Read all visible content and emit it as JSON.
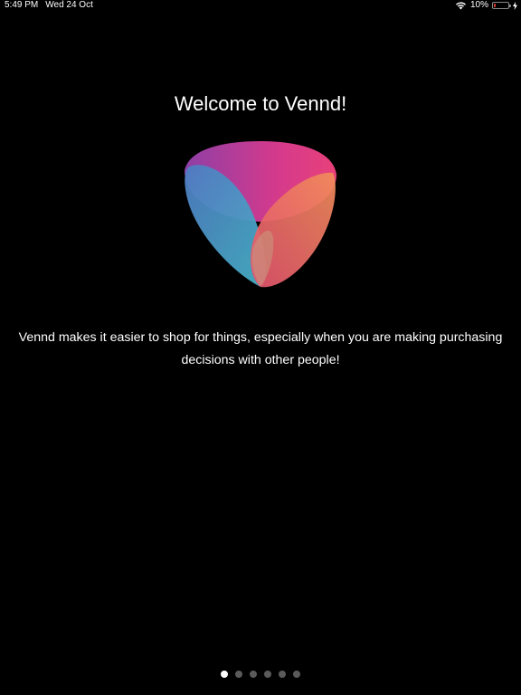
{
  "status_bar": {
    "time": "5:49 PM",
    "date": "Wed 24 Oct",
    "battery_percent": "10%",
    "battery_level": 0.1,
    "battery_color": "#e03a2c",
    "icons": [
      "wifi-icon",
      "battery-icon",
      "charging-icon"
    ]
  },
  "onboarding": {
    "title": "Welcome to Vennd!",
    "description": "Vennd makes it easier to shop for things, especially when you are making purchasing decisions with other people!",
    "logo": "vennd-logo",
    "colors": {
      "magenta": "#d63384",
      "purple": "#9b3fa0",
      "blue": "#3f9bc4",
      "orange": "#ee8a54"
    }
  },
  "pagination": {
    "total_pages": 6,
    "current_page": 1
  }
}
